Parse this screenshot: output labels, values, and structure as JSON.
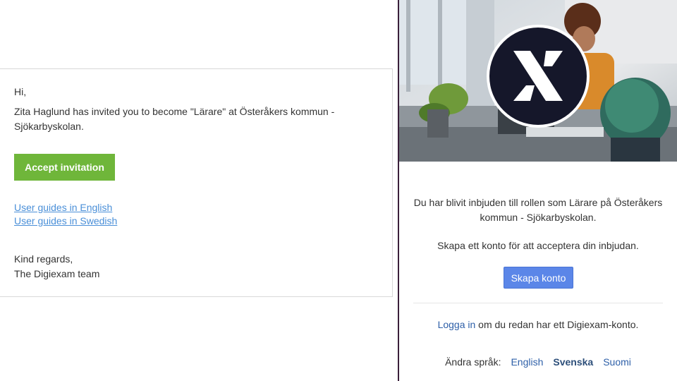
{
  "email": {
    "greeting": "Hi,",
    "invite_message": "Zita Haglund has invited you to become \"Lärare\" at Österåkers kommun - Sjökarbyskolan.",
    "accept_label": "Accept invitation",
    "guides": [
      "User guides in English",
      "User guides in Swedish"
    ],
    "regards": "Kind regards,",
    "team": "The Digiexam team",
    "colors": {
      "accept": "#6fb63a",
      "link": "#4a8fd8"
    }
  },
  "signup": {
    "logo_icon": "digiexam-x-logo-icon",
    "invite_message": "Du har blivit inbjuden till rollen som Lärare på Österåkers kommun - Sjökarbyskolan.",
    "create_message": "Skapa ett konto för att acceptera din inbjudan.",
    "create_label": "Skapa konto",
    "login_link": "Logga in",
    "login_suffix": " om du redan har ett Digiexam-konto.",
    "language_label": "Ändra språk:",
    "languages": [
      "English",
      "Svenska",
      "Suomi"
    ],
    "active_language": "Svenska",
    "colors": {
      "button": "#5b86e8",
      "link": "#2d5fa8"
    }
  }
}
